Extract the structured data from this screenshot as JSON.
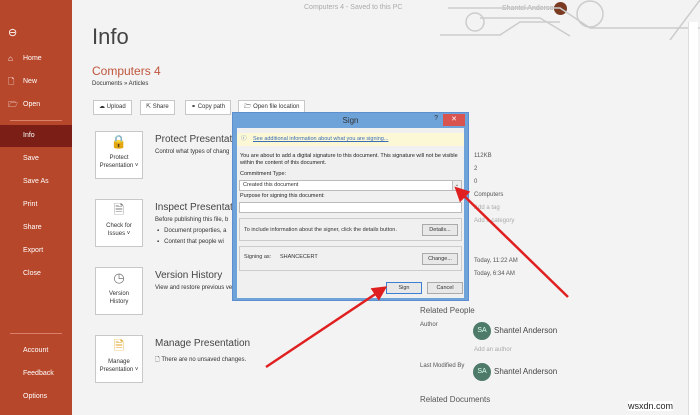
{
  "window": {
    "title": "Computers 4 - Saved to this PC",
    "user": "Shantel Anderson"
  },
  "sidebar": {
    "back": "back-icon",
    "items": [
      {
        "label": "Home",
        "icon": "⌂"
      },
      {
        "label": "New",
        "icon": "🗋"
      },
      {
        "label": "Open",
        "icon": "🗁"
      }
    ],
    "items2": [
      "Info",
      "Save",
      "Save As",
      "Print",
      "Share",
      "Export",
      "Close"
    ],
    "bottom": [
      "Account",
      "Feedback",
      "Options"
    ]
  },
  "page": {
    "title": "Info",
    "doc_name": "Computers 4",
    "path": "Documents » Articles",
    "toolbar": [
      "Upload",
      "Share",
      "Copy path",
      "Open file location"
    ]
  },
  "sections": [
    {
      "btn1": "Protect",
      "btn2": "Presentation ˅",
      "title": "Protect Presentation",
      "desc": "Control what types of chang"
    },
    {
      "btn1": "Check for",
      "btn2": "Issues ˅",
      "title": "Inspect Presentation",
      "desc": "Before publishing this file, b",
      "bullets": [
        "Document properties, a",
        "Content that people wi"
      ]
    },
    {
      "btn1": "Version",
      "btn2": "History",
      "title": "Version History",
      "desc": "View and restore previous ve"
    },
    {
      "btn1": "Manage",
      "btn2": "Presentation ˅",
      "title": "Manage Presentation",
      "desc": "There are no unsaved changes."
    }
  ],
  "properties": {
    "values": [
      "112KB",
      "2",
      "0",
      "Computers",
      "Add a tag",
      "Add a category"
    ],
    "dates": [
      "Today, 11:22 AM",
      "Today, 6:34 AM"
    ]
  },
  "related": {
    "people_heading": "Related People",
    "author_label": "Author",
    "author": "Shantel Anderson",
    "initials": "SA",
    "add_author": "Add an author",
    "modified_label": "Last Modified By",
    "modified_by": "Shantel Anderson",
    "docs_heading": "Related Documents"
  },
  "dialog": {
    "title": "Sign",
    "help": "?",
    "close": "✕",
    "info_link": "See additional information about what you are signing...",
    "intro": "You are about to add a digital signature to this document. This signature will not be visible within the content of this document.",
    "commitment_label": "Commitment Type:",
    "commitment_value": "Created this document",
    "purpose_label": "Purpose for signing this document:",
    "purpose_value": "",
    "details_text": "To include information about the signer, click the details button.",
    "details_btn": "Details...",
    "signing_as_label": "Signing as:",
    "signing_as": "SHANCECERT",
    "change_btn": "Change...",
    "sign_btn": "Sign",
    "cancel_btn": "Cancel"
  },
  "watermark": "wsxdn.com"
}
